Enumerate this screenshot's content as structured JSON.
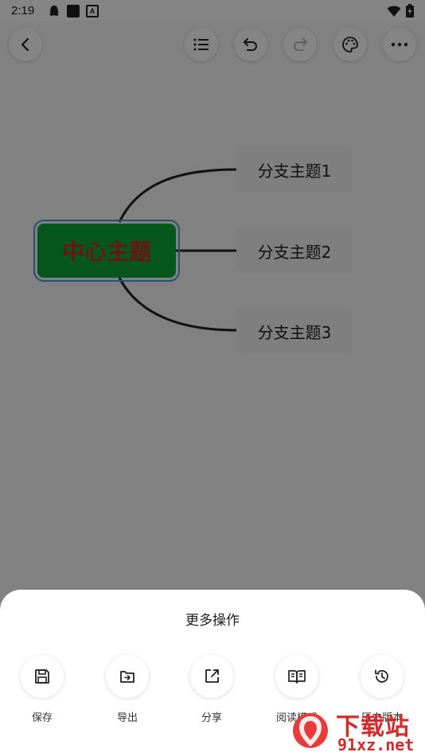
{
  "status_bar": {
    "time": "2:19",
    "icons": [
      "qq-icon",
      "square-icon",
      "a-badge-icon"
    ],
    "right_icons": [
      "wifi-icon",
      "battery-charging-icon"
    ]
  },
  "toolbar": {
    "back": "back-icon",
    "outline": "list-icon",
    "undo": "undo-icon",
    "redo": "redo-icon",
    "theme": "palette-icon",
    "more": "more-icon"
  },
  "mindmap": {
    "center": "中心主题",
    "branches": [
      "分支主题1",
      "分支主题2",
      "分支主题3"
    ],
    "colors": {
      "center_bg": "#0aa83a",
      "center_text": "#d4282a",
      "selection": "#4a9adf"
    }
  },
  "sheet": {
    "title": "更多操作",
    "actions": [
      {
        "label": "保存",
        "icon": "save-icon"
      },
      {
        "label": "导出",
        "icon": "export-icon"
      },
      {
        "label": "分享",
        "icon": "share-icon"
      },
      {
        "label": "阅读模式",
        "icon": "read-mode-icon"
      },
      {
        "label": "历史版本",
        "icon": "history-icon"
      }
    ]
  },
  "watermark": {
    "main": "下载站",
    "sub": "91xz.net"
  }
}
